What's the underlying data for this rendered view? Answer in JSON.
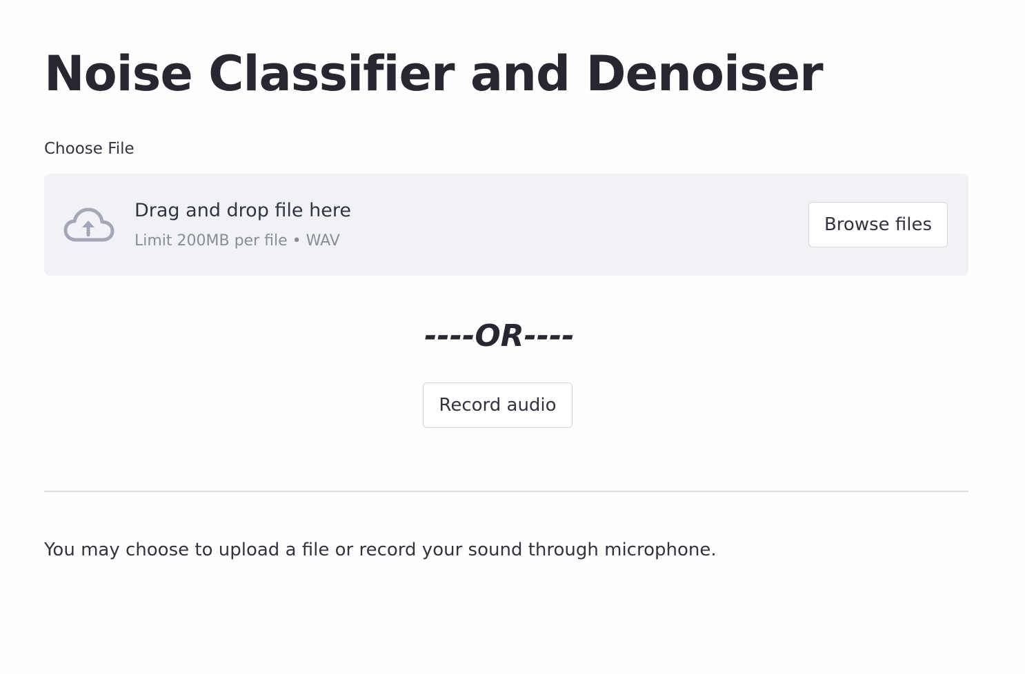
{
  "page": {
    "title": "Noise Classifier and Denoiser"
  },
  "uploader": {
    "label": "Choose File",
    "dropzone_text": "Drag and drop file here",
    "limit_text": "Limit 200MB per file • WAV",
    "browse_label": "Browse files",
    "icon": "cloud-upload-icon"
  },
  "separator": {
    "text": "----OR----"
  },
  "recorder": {
    "button_label": "Record audio"
  },
  "footer": {
    "help_text": "You may choose to upload a file or record your sound through microphone."
  },
  "colors": {
    "dropzone_bg": "#f0f2f6",
    "icon": "#a3a8b8",
    "text": "#31333f",
    "muted_text": "#8a8d96"
  }
}
